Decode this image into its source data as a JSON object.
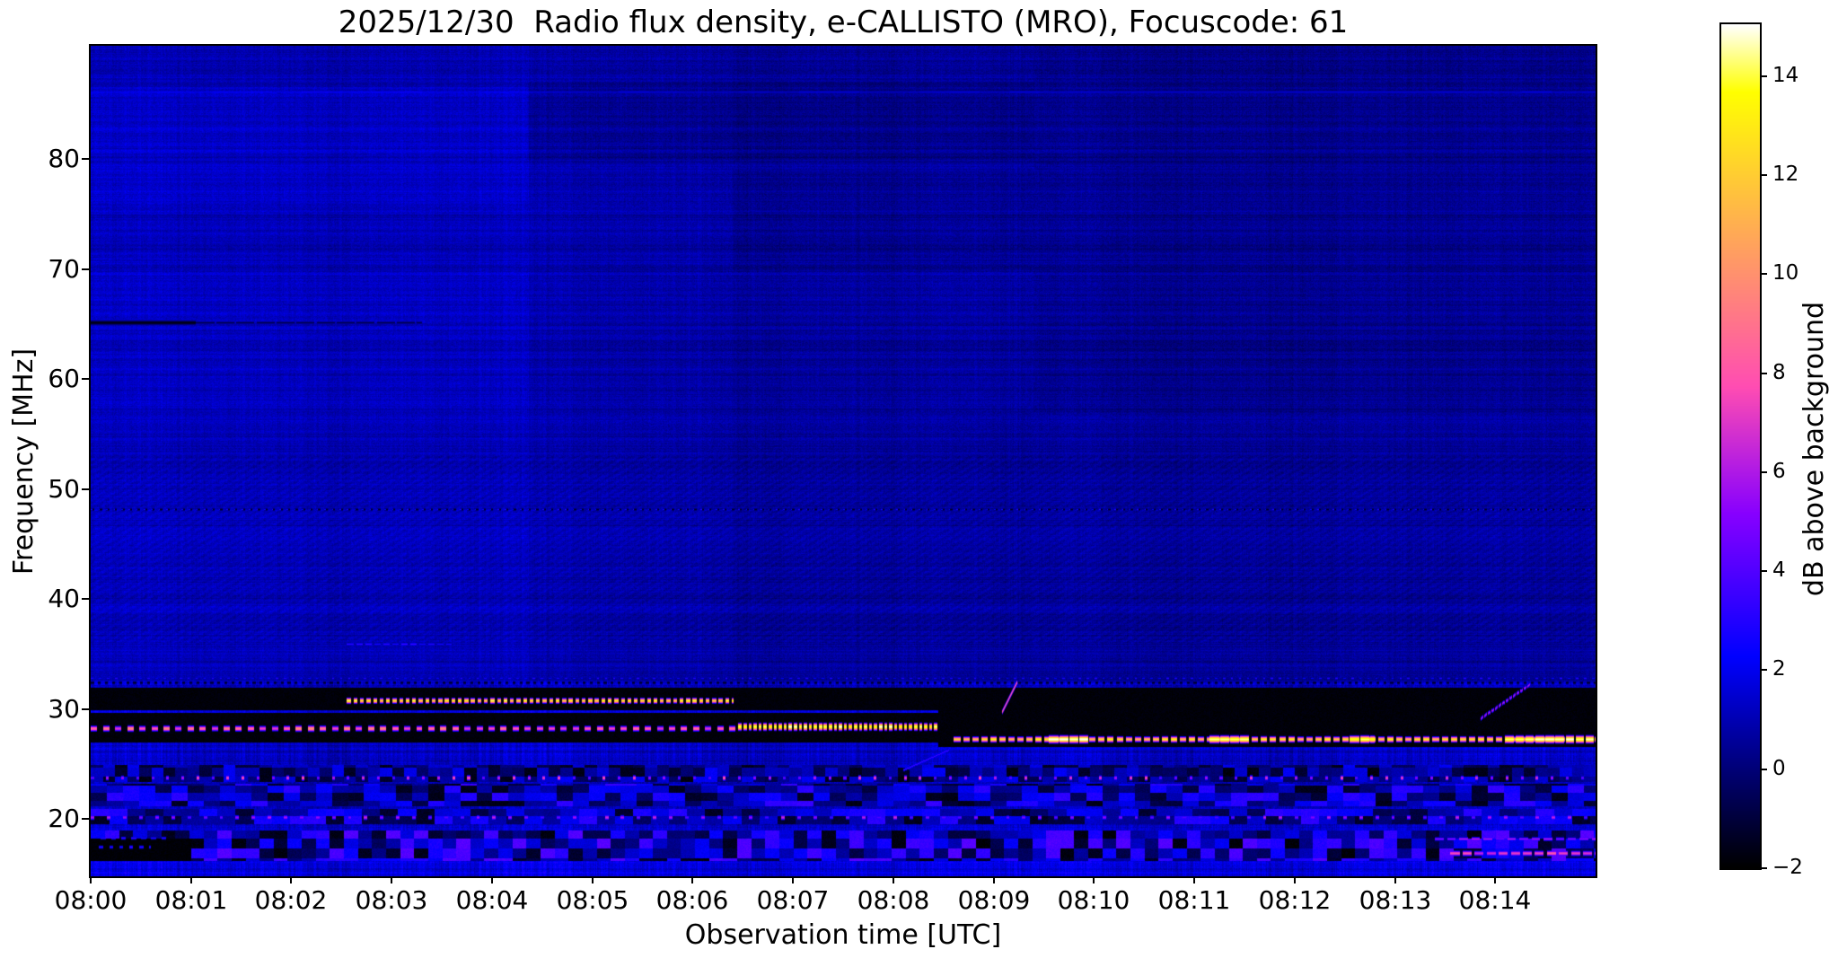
{
  "figure": {
    "title": "2025/12/30  Radio flux density, e-CALLISTO (MRO), Focuscode: 61",
    "xlabel": "Observation time [UTC]",
    "ylabel": "Frequency [MHz]",
    "colorbar_label": "dB above background",
    "background_color": "#ffffff",
    "text_color": "#000000"
  },
  "chart_data": {
    "type": "heatmap",
    "title": "2025/12/30  Radio flux density, e-CALLISTO (MRO), Focuscode: 61",
    "xlabel": "Observation time [UTC]",
    "ylabel": "Frequency [MHz]",
    "x_start_label": "08:00",
    "x_range_minutes": [
      0,
      15
    ],
    "x_ticks": [
      {
        "label": "08:00",
        "minute": 0
      },
      {
        "label": "08:01",
        "minute": 1
      },
      {
        "label": "08:02",
        "minute": 2
      },
      {
        "label": "08:03",
        "minute": 3
      },
      {
        "label": "08:04",
        "minute": 4
      },
      {
        "label": "08:05",
        "minute": 5
      },
      {
        "label": "08:06",
        "minute": 6
      },
      {
        "label": "08:07",
        "minute": 7
      },
      {
        "label": "08:08",
        "minute": 8
      },
      {
        "label": "08:09",
        "minute": 9
      },
      {
        "label": "08:10",
        "minute": 10
      },
      {
        "label": "08:11",
        "minute": 11
      },
      {
        "label": "08:12",
        "minute": 12
      },
      {
        "label": "08:13",
        "minute": 13
      },
      {
        "label": "08:14",
        "minute": 14
      }
    ],
    "ylim": [
      14.8,
      90.3
    ],
    "y_ticks": [
      {
        "label": "20",
        "value": 20
      },
      {
        "label": "30",
        "value": 30
      },
      {
        "label": "40",
        "value": 40
      },
      {
        "label": "50",
        "value": 50
      },
      {
        "label": "60",
        "value": 60
      },
      {
        "label": "70",
        "value": 70
      },
      {
        "label": "80",
        "value": 80
      }
    ],
    "grid": false,
    "colorbar": {
      "label": "dB above background",
      "vmin": -2,
      "vmax": 15.05,
      "colormap": "gnuplot2",
      "ticks": [
        {
          "label": "14",
          "value": 14
        },
        {
          "label": "12",
          "value": 12
        },
        {
          "label": "10",
          "value": 10
        },
        {
          "label": "8",
          "value": 8
        },
        {
          "label": "6",
          "value": 6
        },
        {
          "label": "4",
          "value": 4
        },
        {
          "label": "2",
          "value": 2
        },
        {
          "label": "0",
          "value": 0
        },
        {
          "label": "−2",
          "value": -2
        }
      ]
    },
    "texture": {
      "base_db_upper": 0.7,
      "base_db_lower": 0.95,
      "lower_upper_split_mhz": 32.5,
      "row_noise": 0.55,
      "row_band_noise": 0.5,
      "col_noise": 0.5,
      "speckle": 0.8,
      "herringbone_zone_mhz": [
        36,
        53
      ],
      "herringbone_amp": 0.2
    },
    "regions": [
      {
        "t0": 0,
        "t1": 4.36,
        "f0": 32.5,
        "f1": 90.3,
        "delta": 0.32
      },
      {
        "t0": 0,
        "t1": 4.36,
        "f0": 76,
        "f1": 86.5,
        "delta": 0.25
      },
      {
        "t0": 0,
        "t1": 4.36,
        "f0": 57,
        "f1": 70,
        "delta": 0.15
      },
      {
        "t0": 4.36,
        "t1": 6.4,
        "f0": 32.5,
        "f1": 90.3,
        "delta": 0.05
      },
      {
        "t0": 4.36,
        "t1": 9.4,
        "f0": 80,
        "f1": 87,
        "delta": -0.3
      },
      {
        "t0": 6.4,
        "t1": 15,
        "f0": 32.5,
        "f1": 90.3,
        "delta": -0.12
      },
      {
        "t0": 6.4,
        "t1": 9.4,
        "f0": 70,
        "f1": 79,
        "delta": -0.2
      },
      {
        "t0": 9.4,
        "t1": 15,
        "f0": 57,
        "f1": 90.3,
        "delta": -0.25
      },
      {
        "t0": 8.45,
        "t1": 15,
        "f0": 32.5,
        "f1": 57,
        "delta": -0.08
      },
      {
        "t0": 0,
        "t1": 15,
        "f0": 14.8,
        "f1": 32.5,
        "delta": 0.3
      },
      {
        "t0": 0,
        "t1": 15,
        "f0": 14.8,
        "f1": 16.2,
        "delta": 0.45
      },
      {
        "t0": 0,
        "t1": 15,
        "f0": 44,
        "f1": 52,
        "delta": 0.12
      }
    ],
    "mottles": [
      {
        "t0": 0,
        "t1": 15,
        "f0": 16.2,
        "f1": 18.9,
        "lo": -1.9,
        "hi": 4.2,
        "cw": 0.14,
        "ch": 0.9
      },
      {
        "t0": 0,
        "t1": 15,
        "f0": 19.6,
        "f1": 20.9,
        "lo": -1.5,
        "hi": 3.2,
        "cw": 0.18,
        "ch": 0.7
      },
      {
        "t0": 0,
        "t1": 15,
        "f0": 21.2,
        "f1": 23.2,
        "lo": -1.7,
        "hi": 3.4,
        "cw": 0.16,
        "ch": 0.7
      },
      {
        "t0": 0,
        "t1": 15,
        "f0": 23.4,
        "f1": 24.9,
        "lo": -1.8,
        "hi": 2.2,
        "cw": 0.12,
        "ch": 0.8
      }
    ],
    "dark_bands": [
      {
        "t0": 0,
        "t1": 15,
        "f0": 29.9,
        "f1": 31.9,
        "db": -1.85
      },
      {
        "t0": 0,
        "t1": 8.45,
        "f0": 27.0,
        "f1": 29.6,
        "db": -1.85
      },
      {
        "t0": 8.45,
        "t1": 15,
        "f0": 26.6,
        "f1": 30.1,
        "db": -1.85
      },
      {
        "t0": 0,
        "t1": 1.0,
        "f0": 16.2,
        "f1": 18.2,
        "db": -1.9
      }
    ],
    "dark_lines": [
      {
        "f": 65.2,
        "t0": 0,
        "t1": 1.05,
        "db": -1.8,
        "thick": 3,
        "duty": 1,
        "period": 0.2
      },
      {
        "f": 65.2,
        "t0": 1.05,
        "t1": 3.3,
        "db": -0.8,
        "thick": 2,
        "duty": 0.9,
        "period": 0.2
      },
      {
        "f": 48.15,
        "t0": 0,
        "t1": 15,
        "db": -1.4,
        "thick": 2,
        "duty": 0.45,
        "period": 0.075
      },
      {
        "f": 32.4,
        "t0": 0,
        "t1": 15,
        "db": -1.5,
        "thick": 2,
        "duty": 0.4,
        "period": 0.07
      }
    ],
    "bright_lines": [
      {
        "f": 86.1,
        "t0": 0,
        "t1": 4.36,
        "db": 2.2,
        "thick": 2,
        "duty": 1,
        "period": 0.3,
        "fall": 1.2,
        "jit": 0.3
      },
      {
        "f": 86.1,
        "t0": 4.36,
        "t1": 15,
        "db": 1.7,
        "thick": 2,
        "duty": 1,
        "period": 0.3,
        "fall": 1.2,
        "jit": 0.3
      },
      {
        "f": 48.15,
        "t0": 0,
        "t1": 15,
        "db": 2.6,
        "thick": 2,
        "duty": 0.18,
        "period": 0.075,
        "fall": 2.0,
        "jit": 0.5
      },
      {
        "f": 35.9,
        "t0": 2.55,
        "t1": 3.6,
        "db": 3.1,
        "thick": 2,
        "duty": 0.7,
        "period": 0.09,
        "fall": 1.6,
        "jit": 0.5
      },
      {
        "f": 32.8,
        "t0": 0,
        "t1": 15,
        "db": 2.6,
        "thick": 2,
        "duty": 0.3,
        "period": 0.08,
        "fall": 2.0,
        "jit": 0.6
      },
      {
        "f": 30.8,
        "t0": 2.55,
        "t1": 6.41,
        "db": 13.0,
        "thick": 2,
        "duty": 0.6,
        "period": 0.065,
        "fall": 2.2,
        "jit": 1.2
      },
      {
        "f": 28.3,
        "t0": 0,
        "t1": 6.45,
        "db": 8.3,
        "thick": 3,
        "duty": 0.52,
        "period": 0.12,
        "fall": 1.8,
        "jit": 1.6
      },
      {
        "f": 28.4,
        "t0": 6.45,
        "t1": 8.45,
        "db": 14.2,
        "thick": 3,
        "duty": 0.65,
        "period": 0.05,
        "fall": 1.8,
        "jit": 1.0
      },
      {
        "f": 27.3,
        "t0": 8.6,
        "t1": 15,
        "db": 12.5,
        "thick": 2,
        "duty": 0.7,
        "period": 0.09,
        "fall": 2.0,
        "jit": 1.2
      },
      {
        "f": 27.3,
        "t0": 9.55,
        "t1": 9.95,
        "db": 15.0,
        "thick": 3,
        "duty": 0.9,
        "period": 0.1,
        "fall": 1.8,
        "jit": 0.4
      },
      {
        "f": 27.3,
        "t0": 11.15,
        "t1": 11.55,
        "db": 14.6,
        "thick": 3,
        "duty": 0.9,
        "period": 0.1,
        "fall": 1.8,
        "jit": 0.4
      },
      {
        "f": 27.3,
        "t0": 12.55,
        "t1": 12.8,
        "db": 14.0,
        "thick": 3,
        "duty": 0.9,
        "period": 0.1,
        "fall": 1.8,
        "jit": 0.4
      },
      {
        "f": 27.3,
        "t0": 14.1,
        "t1": 15,
        "db": 14.5,
        "thick": 3,
        "duty": 0.85,
        "period": 0.1,
        "fall": 1.8,
        "jit": 0.5
      },
      {
        "f": 23.8,
        "t0": 0,
        "t1": 15,
        "db": 6.0,
        "thick": 3,
        "duty": 0.18,
        "period": 0.15,
        "fall": 1.7,
        "jit": 2.0
      },
      {
        "f": 20.2,
        "t0": 0,
        "t1": 15,
        "db": 5.0,
        "thick": 3,
        "duty": 0.22,
        "period": 0.16,
        "fall": 1.7,
        "jit": 1.5
      },
      {
        "f": 16.9,
        "t0": 13.55,
        "t1": 15,
        "db": 7.0,
        "thick": 3,
        "duty": 0.75,
        "period": 0.12,
        "fall": 1.8,
        "jit": 1.0
      },
      {
        "f": 18.2,
        "t0": 13.4,
        "t1": 15,
        "db": 5.5,
        "thick": 2,
        "duty": 0.7,
        "period": 0.12,
        "fall": 1.8,
        "jit": 1.0
      },
      {
        "f": 17.5,
        "t0": 0.08,
        "t1": 0.6,
        "db": 3.5,
        "thick": 2,
        "duty": 0.4,
        "period": 0.1,
        "fall": 1.6,
        "jit": 0.5
      },
      {
        "f": 18.3,
        "t0": 0.1,
        "t1": 0.8,
        "db": 3.0,
        "thick": 2,
        "duty": 0.5,
        "period": 0.1,
        "fall": 1.6,
        "jit": 0.5
      }
    ],
    "diagonals": [
      {
        "t0": 8.1,
        "f0": 24.5,
        "t1": 8.55,
        "f1": 26.3,
        "db": 3.5,
        "thick": 2,
        "duty": 0.8,
        "fall": 1.6
      },
      {
        "t0": 9.08,
        "f0": 29.8,
        "t1": 9.23,
        "f1": 32.4,
        "db": 9.0,
        "thick": 2,
        "duty": 0.85,
        "fall": 1.9
      },
      {
        "t0": 13.85,
        "f0": 29.2,
        "t1": 14.35,
        "f1": 32.3,
        "db": 6.0,
        "thick": 2,
        "duty": 0.55,
        "fall": 1.8
      }
    ]
  }
}
